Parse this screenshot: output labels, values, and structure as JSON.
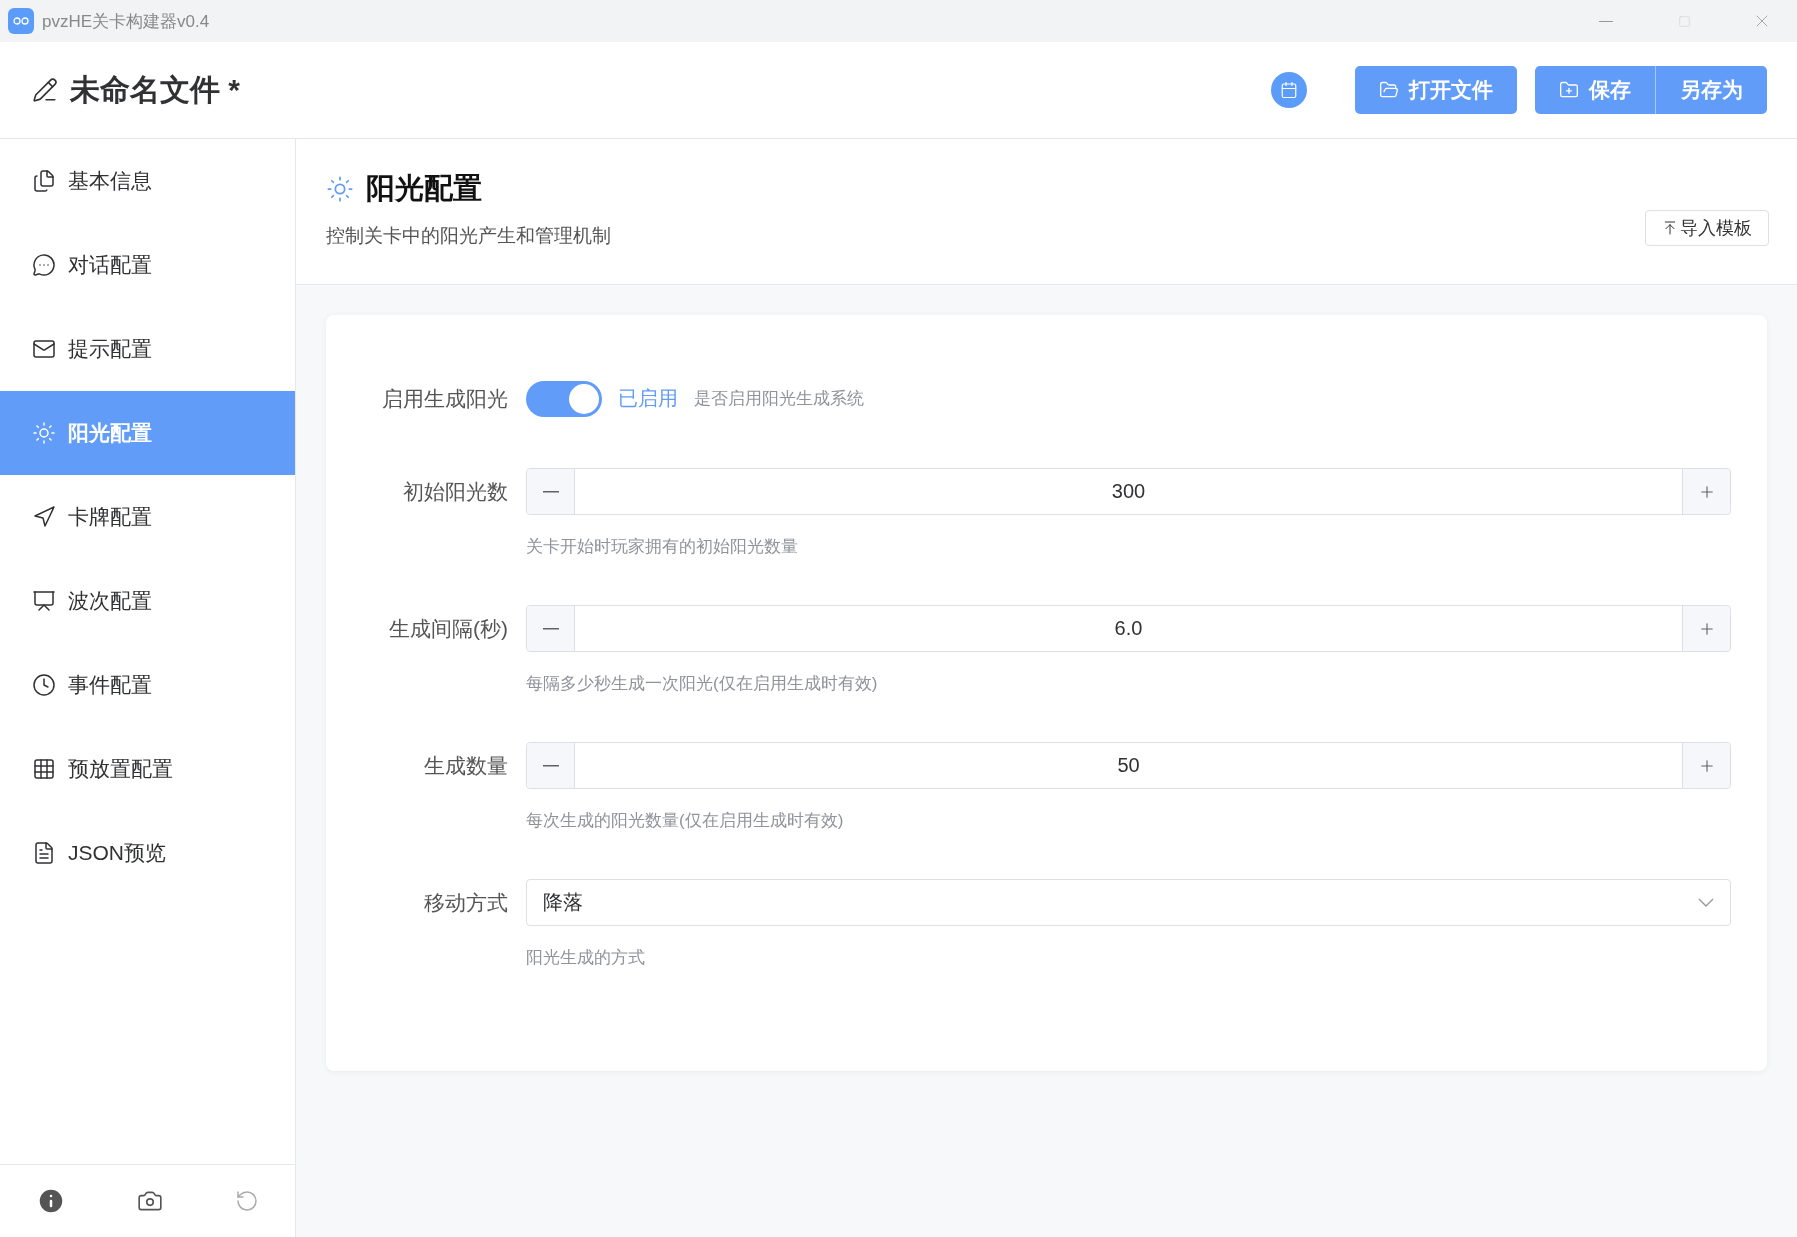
{
  "window": {
    "title": "pvzHE关卡构建器v0.4"
  },
  "header": {
    "file_title": "未命名文件 *",
    "buttons": [
      {
        "label": "打开文件",
        "kind": "open"
      },
      {
        "label": "保存",
        "kind": "save"
      },
      {
        "label": "另存为",
        "kind": "saveas"
      }
    ]
  },
  "sidebar": {
    "items": [
      {
        "label": "基本信息",
        "selected": false
      },
      {
        "label": "对话配置",
        "selected": false
      },
      {
        "label": "提示配置",
        "selected": false
      },
      {
        "label": "阳光配置",
        "selected": true
      },
      {
        "label": "卡牌配置",
        "selected": false
      },
      {
        "label": "波次配置",
        "selected": false
      },
      {
        "label": "事件配置",
        "selected": false
      },
      {
        "label": "预放置配置",
        "selected": false
      },
      {
        "label": "JSON预览",
        "selected": false
      }
    ]
  },
  "page": {
    "title": "阳光配置",
    "description": "控制关卡中的阳光产生和管理机制",
    "import_button": "导入模板"
  },
  "form": [
    {
      "kind": "switch",
      "label": "启用生成阳光",
      "on": true,
      "state_text": "已启用",
      "help": "是否启用阳光生成系统"
    },
    {
      "kind": "number",
      "label": "初始阳光数",
      "value": "300",
      "help": "关卡开始时玩家拥有的初始阳光数量"
    },
    {
      "kind": "number",
      "label": "生成间隔(秒)",
      "value": "6.0",
      "help": "每隔多少秒生成一次阳光(仅在启用生成时有效)"
    },
    {
      "kind": "number",
      "label": "生成数量",
      "value": "50",
      "help": "每次生成的阳光数量(仅在启用生成时有效)"
    },
    {
      "kind": "select",
      "label": "移动方式",
      "value": "降落",
      "help": "阳光生成的方式"
    }
  ]
}
